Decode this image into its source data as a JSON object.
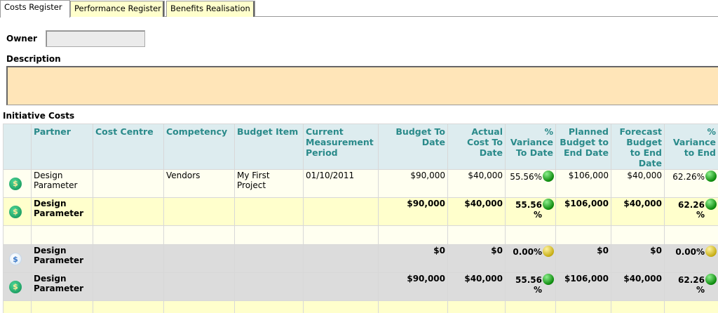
{
  "tabs": [
    {
      "label": "Costs Register",
      "active": true
    },
    {
      "label": "Performance Register",
      "active": false
    },
    {
      "label": "Benefits Realisation",
      "active": false
    }
  ],
  "form": {
    "owner_label": "Owner",
    "owner_value": "",
    "description_label": "Description",
    "description_value": ""
  },
  "section_title": "Initiative Costs",
  "table": {
    "headers": [
      "",
      "Partner",
      "Cost Centre",
      "Competency",
      "Budget Item",
      "Current Measurement Period",
      "Budget To Date",
      "Actual Cost To Date",
      "% Variance To Date",
      "Planned Budget to End Date",
      "Forecast Budget to End Date",
      "% Variance to End"
    ],
    "rows": [
      {
        "partner": "Design Parameter",
        "cost_centre": "",
        "competency": "Vendors",
        "budget_item": "My First Project",
        "period": "01/10/2011",
        "budget_to_date": "$90,000",
        "actual_cost": "$40,000",
        "variance_to_date": "55.56%",
        "planned_budget": "$106,000",
        "forecast_budget": "$40,000",
        "variance_to_end": "62.26%"
      },
      {
        "partner": "Design Parameter",
        "cost_centre": "",
        "competency": "",
        "budget_item": "",
        "period": "",
        "budget_to_date": "$90,000",
        "actual_cost": "$40,000",
        "variance_to_date_num": "55.56",
        "variance_to_date_unit": "%",
        "planned_budget": "$106,000",
        "forecast_budget": "$40,000",
        "variance_to_end_num": "62.26",
        "variance_to_end_unit": "%"
      },
      {
        "partner": "Design Parameter",
        "budget_to_date": "$0",
        "actual_cost": "$0",
        "variance_to_date": "0.00%",
        "planned_budget": "$0",
        "forecast_budget": "$0",
        "variance_to_end": "0.00%"
      },
      {
        "partner": "Design Parameter",
        "budget_to_date": "$90,000",
        "actual_cost": "$40,000",
        "variance_to_date_num": "55.56",
        "variance_to_date_unit": "%",
        "planned_budget": "$106,000",
        "forecast_budget": "$40,000",
        "variance_to_end_num": "62.26",
        "variance_to_end_unit": "%"
      }
    ],
    "status_icon_glyph": "$",
    "colors": {
      "on_track": "#0c8a0c",
      "warning": "#c7ae14",
      "header_text": "#2a8a8a",
      "header_bg": "#ddecef",
      "total_row_bg": "#ffffcc",
      "summary_row_bg": "#dcdcdc"
    }
  }
}
